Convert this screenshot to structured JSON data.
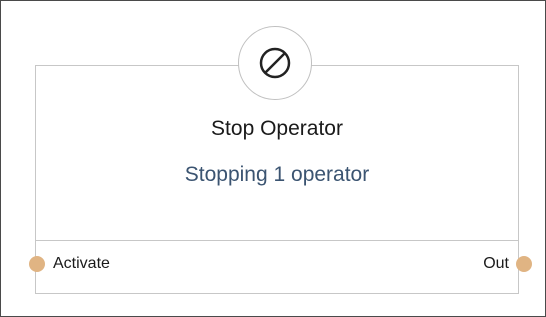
{
  "node": {
    "title": "Stop Operator",
    "subtitle": "Stopping 1 operator",
    "icon": "stop-icon",
    "ports": {
      "input_label": "Activate",
      "output_label": "Out",
      "port_color": "#e0b483"
    }
  },
  "colors": {
    "subtitle": "#3b5471",
    "border": "#c7c7c7"
  }
}
